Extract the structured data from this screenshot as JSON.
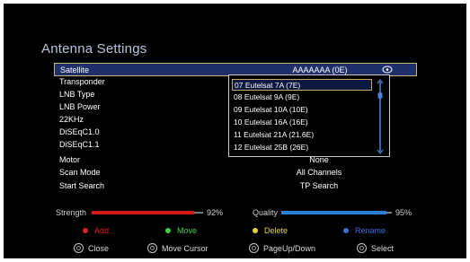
{
  "title": "Antenna Settings",
  "menu": [
    {
      "label": "Satellite",
      "value": "AAAAAAA (0E)"
    },
    {
      "label": "Transponder",
      "value": ""
    },
    {
      "label": "LNB Type",
      "value": ""
    },
    {
      "label": "LNB Power",
      "value": ""
    },
    {
      "label": "22KHz",
      "value": ""
    },
    {
      "label": "DiSEqC1.0",
      "value": ""
    },
    {
      "label": "DiSEqC1.1",
      "value": ""
    },
    {
      "label": "Motor",
      "value": "None"
    },
    {
      "label": "Scan Mode",
      "value": "All Channels"
    },
    {
      "label": "Start Search",
      "value": "TP Search"
    }
  ],
  "dropdown": {
    "items": [
      "07  Eutelsat 7A (7E)",
      "08  Eutelsat 9A (9E)",
      "09  Eutelsat 10A (10E)",
      "10  Eutelsat 16A (16E)",
      "11  Eutelsat 21A (21.6E)",
      "12  Eutelsat 25B (26E)"
    ],
    "selected_index": 0
  },
  "signal": {
    "strength_label": "Strength",
    "strength_pct": "92%",
    "strength_value": 0.92,
    "quality_label": "Quality",
    "quality_pct": "95%",
    "quality_value": 0.95
  },
  "color_keys": {
    "red": "Add",
    "green": "Move",
    "yellow": "Delete",
    "blue": "Rename"
  },
  "nav": {
    "close": "Close",
    "move_cursor": "Move Cursor",
    "page": "PageUp/Down",
    "select": "Select"
  },
  "colors": {
    "red": "#e02020",
    "green": "#3cd23c",
    "yellow": "#e6d23a",
    "blue": "#3a6fe0",
    "strength_bar": "#d01818",
    "quality_bar": "#2a7fd4"
  }
}
